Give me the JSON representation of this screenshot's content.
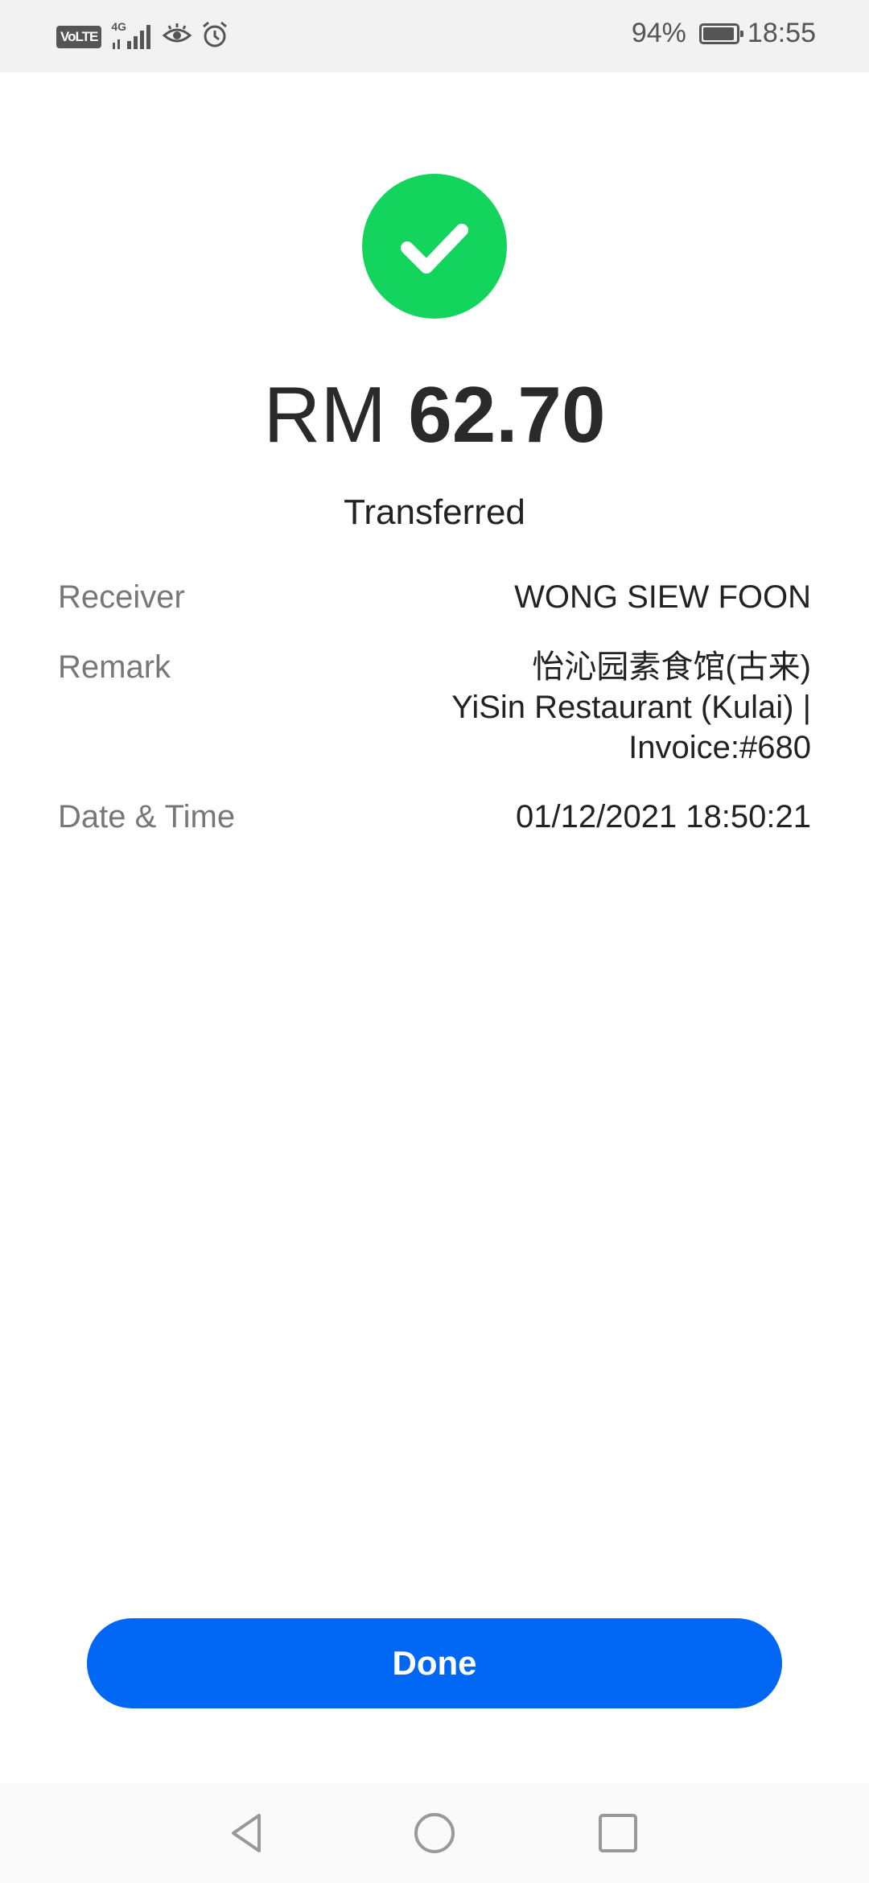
{
  "status_bar": {
    "volte_label": "VoLTE",
    "network_label": "4G",
    "battery_percent": "94%",
    "battery_level": 0.94,
    "time": "18:55"
  },
  "receipt": {
    "status_icon": "checkmark-circle-icon",
    "currency": "RM",
    "amount": "62.70",
    "status": "Transferred",
    "accent_color": "#13d55d",
    "details": {
      "receiver": {
        "label": "Receiver",
        "value": "WONG SIEW FOON"
      },
      "remark": {
        "label": "Remark",
        "lines": [
          "怡沁园素食馆(古来)",
          "YiSin Restaurant (Kulai) |",
          "Invoice:#680"
        ]
      },
      "datetime": {
        "label": "Date & Time",
        "value": "01/12/2021 18:50:21"
      }
    }
  },
  "actions": {
    "done_label": "Done",
    "button_color": "#0067f5"
  },
  "nav_bar": {
    "back_icon": "back-triangle-icon",
    "home_icon": "home-circle-icon",
    "recents_icon": "recents-square-icon"
  }
}
